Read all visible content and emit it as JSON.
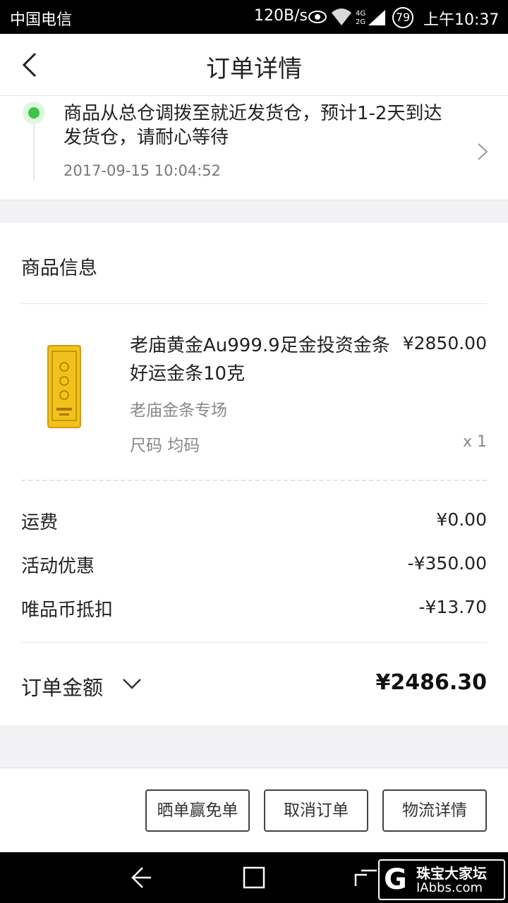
{
  "status_bar": {
    "carrier": "中国电信",
    "speed": "120B/s",
    "network_badge": "4G 2G",
    "battery": "79",
    "time": "上午10:37"
  },
  "header": {
    "title": "订单详情"
  },
  "logistics": {
    "message": "商品从总仓调拨至就近发货仓，预计1-2天到达发货仓，请耐心等待",
    "timestamp": "2017-09-15 10:04:52",
    "status_color": "#3fc447"
  },
  "product_section": {
    "title": "商品信息",
    "item": {
      "name": "老庙黄金Au999.9足金投资金条好运金条10克",
      "price": "¥2850.00",
      "shop": "老庙金条专场",
      "size": "尺码 均码",
      "quantity": "x 1"
    }
  },
  "summary": {
    "rows": [
      {
        "label": "运费",
        "value": "¥0.00"
      },
      {
        "label": "活动优惠",
        "value": "-¥350.00"
      },
      {
        "label": "唯品币抵扣",
        "value": "-¥13.70"
      }
    ],
    "total_label": "订单金额",
    "total_value": "¥2486.30"
  },
  "actions": {
    "share": "晒单赢免单",
    "cancel": "取消订单",
    "logistics": "物流详情"
  },
  "watermark": {
    "letter": "G",
    "name": "珠宝大家坛",
    "site": "IAbbs.com"
  }
}
